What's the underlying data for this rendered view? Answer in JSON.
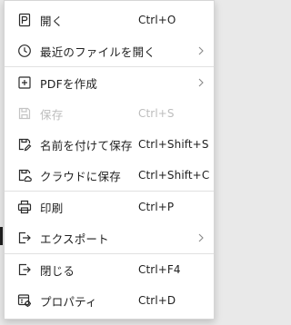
{
  "menu": {
    "items": [
      {
        "label": "開く",
        "shortcut": "Ctrl+O",
        "icon": "open-icon"
      },
      {
        "label": "最近のファイルを開く",
        "icon": "clock-icon",
        "submenu": true
      },
      {
        "label": "PDFを作成",
        "icon": "add-box-icon",
        "submenu": true
      },
      {
        "label": "保存",
        "shortcut": "Ctrl+S",
        "icon": "save-icon",
        "disabled": true
      },
      {
        "label": "名前を付けて保存",
        "shortcut": "Ctrl+Shift+S",
        "icon": "save-as-icon"
      },
      {
        "label": "クラウドに保存",
        "shortcut": "Ctrl+Shift+C",
        "icon": "cloud-save-icon"
      },
      {
        "label": "印刷",
        "shortcut": "Ctrl+P",
        "icon": "printer-icon"
      },
      {
        "label": "エクスポート",
        "icon": "export-icon",
        "submenu": true
      },
      {
        "label": "閉じる",
        "shortcut": "Ctrl+F4",
        "icon": "close-document-icon"
      },
      {
        "label": "プロパティ",
        "shortcut": "Ctrl+D",
        "icon": "properties-icon"
      }
    ]
  }
}
